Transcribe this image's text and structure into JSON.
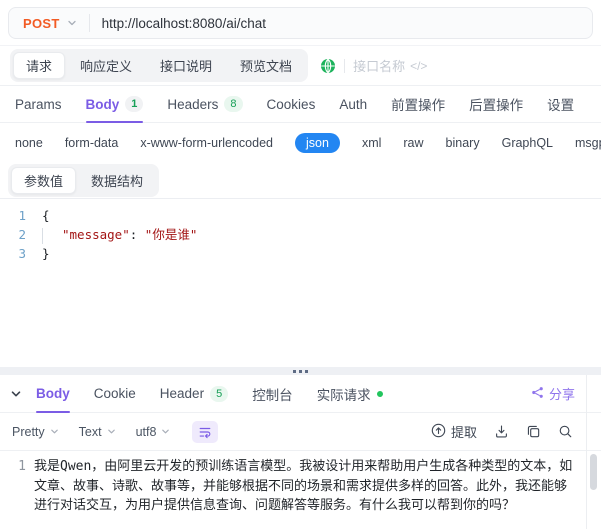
{
  "colors": {
    "method_post": "#F25B24",
    "json_pill_blue": "#2386F2",
    "accent_purple": "#7B5CE5",
    "badge_green": "#18A058",
    "status_dot_green": "#22C55E",
    "string_red": "#A31515",
    "globe_green": "#1DB35C"
  },
  "request_bar": {
    "method": "POST",
    "url": "http://localhost:8080/ai/chat"
  },
  "doc_tabs": {
    "request": "请求",
    "response_def": "响应定义",
    "api_desc": "接口说明",
    "preview_doc": "预览文档",
    "endpoint_placeholder": "接口名称",
    "code_glyph": "</>"
  },
  "request_tabs": {
    "params": "Params",
    "body": "Body",
    "body_count": "1",
    "headers": "Headers",
    "headers_count": "8",
    "cookies": "Cookies",
    "auth": "Auth",
    "pre_ops": "前置操作",
    "post_ops": "后置操作",
    "settings": "设置"
  },
  "body_types": {
    "none": "none",
    "form_data": "form-data",
    "urlencoded": "x-www-form-urlencoded",
    "json": "json",
    "xml": "xml",
    "raw": "raw",
    "binary": "binary",
    "graphql": "GraphQL",
    "msgpack": "msgpack"
  },
  "param_view_tabs": {
    "value": "参数值",
    "schema": "数据结构"
  },
  "editor": {
    "line1_num": "1",
    "line2_num": "2",
    "line3_num": "3",
    "open_brace": "{",
    "key": "\"message\"",
    "separator": ": ",
    "value": "\"你是谁\"",
    "close_brace": "}"
  },
  "response_panel": {
    "tabs": {
      "body": "Body",
      "cookie": "Cookie",
      "header": "Header",
      "header_count": "5",
      "console": "控制台",
      "actual_request": "实际请求"
    },
    "share": "分享",
    "toolbar": {
      "format": "Pretty",
      "view": "Text",
      "encoding": "utf8",
      "extract": "提取"
    },
    "body": {
      "line_num": "1",
      "text": "我是Qwen，由阿里云开发的预训练语言模型。我被设计用来帮助用户生成各种类型的文本，如文章、故事、诗歌、故事等，并能够根据不同的场景和需求提供多样的回答。此外，我还能够进行对话交互，为用户提供信息查询、问题解答等服务。有什么我可以帮到你的吗？"
    }
  }
}
